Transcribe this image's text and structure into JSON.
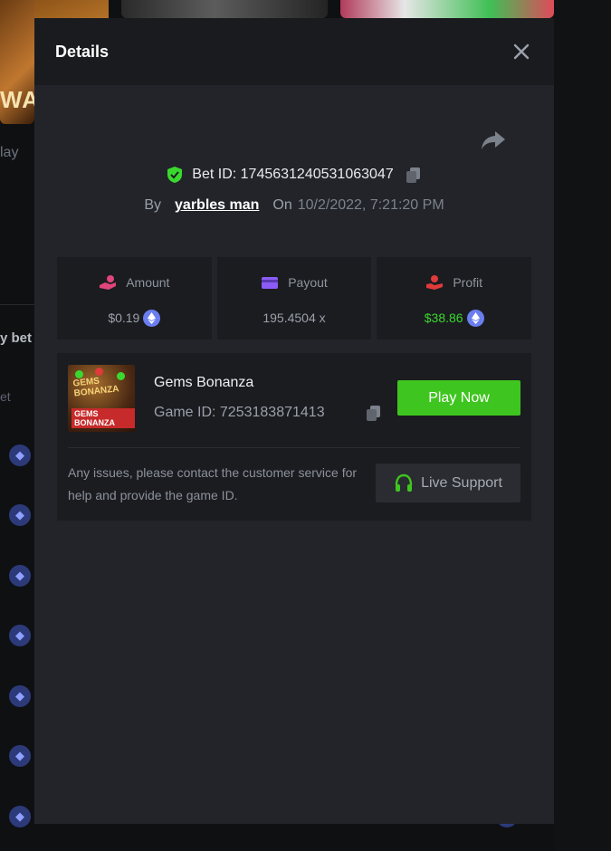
{
  "background": {
    "thumb_text": "WA",
    "play_text": "lay",
    "my_bet_text": "y bet",
    "bet_text": "et"
  },
  "modal": {
    "title": "Details",
    "bet_label": "Bet ID: ",
    "bet_id": "1745631240531063047",
    "by_label": "By",
    "username": "yarbles man",
    "on_label": "On",
    "date": "10/2/2022, 7:21:20 PM"
  },
  "stats": {
    "amount": {
      "label": "Amount",
      "value": "$0.19"
    },
    "payout": {
      "label": "Payout",
      "value": "195.4504 x"
    },
    "profit": {
      "label": "Profit",
      "value": "$38.86"
    }
  },
  "game": {
    "name": "Gems Bonanza",
    "id_label": "Game ID: ",
    "id": "7253183871413",
    "play_label": "Play Now",
    "support_text": "Any issues, please contact the customer service for help and provide the game ID.",
    "support_label": "Live Support",
    "thumb_title": "GEMS BONANZA",
    "thumb_subtitle": "GEMS BONANZA"
  },
  "colors": {
    "accent_green": "#3fc51f",
    "profit_green": "#3ad82e",
    "amount_icon": "#e0457b",
    "payout_icon": "#8a5cf5",
    "profit_icon": "#e03a3a",
    "eth_coin": "#6a7ef0"
  },
  "icons": {
    "close": "close-icon",
    "share": "share-icon",
    "verified": "shield-check-icon",
    "copy": "copy-icon",
    "amount": "hand-coin-icon",
    "payout": "wallet-icon",
    "profit": "person-hand-icon",
    "currency": "ethereum-icon",
    "support": "headset-icon"
  }
}
